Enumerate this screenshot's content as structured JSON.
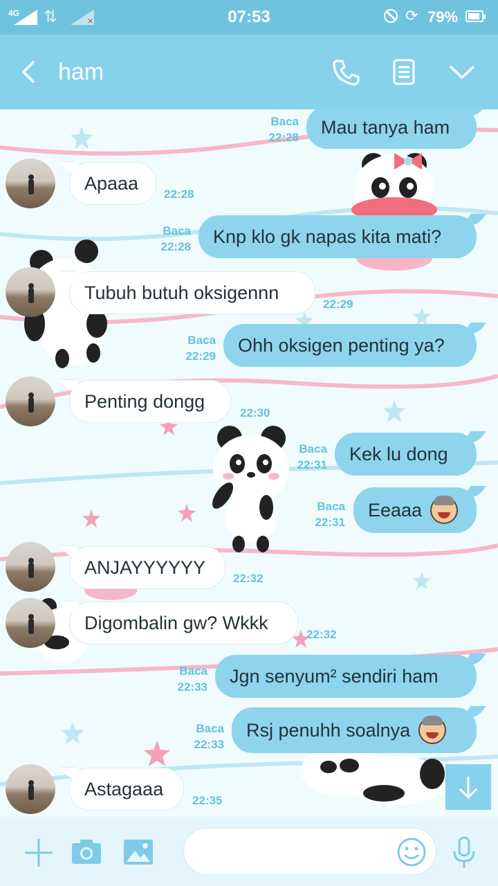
{
  "status_bar": {
    "network": "4G",
    "time": "07:53",
    "battery": "79%",
    "icons": [
      "signal-icon",
      "data-arrows-icon",
      "signal-no-sim-icon",
      "do-not-disturb-icon",
      "rotation-lock-icon",
      "battery-icon"
    ]
  },
  "header": {
    "contact_name": "ham",
    "icons": [
      "back-icon",
      "phone-icon",
      "notes-icon",
      "chevron-down-icon"
    ]
  },
  "messages": [
    {
      "direction": "out",
      "text": "Mau tanya ham",
      "status": "Baca",
      "time": "22:28",
      "emoji": false
    },
    {
      "direction": "in",
      "text": "Apaaa",
      "time": "22:28"
    },
    {
      "direction": "out",
      "text": "Knp klo gk napas kita mati?",
      "status": "Baca",
      "time": "22:28",
      "emoji": false
    },
    {
      "direction": "in",
      "text": "Tubuh butuh oksigennn",
      "time": "22:29"
    },
    {
      "direction": "out",
      "text": "Ohh oksigen penting ya?",
      "status": "Baca",
      "time": "22:29",
      "emoji": false
    },
    {
      "direction": "in",
      "text": "Penting dongg",
      "time": "22:30"
    },
    {
      "direction": "out",
      "text": "Kek lu dong",
      "status": "Baca",
      "time": "22:31",
      "emoji": false
    },
    {
      "direction": "out",
      "text": "Eeaaa",
      "status": "Baca",
      "time": "22:31",
      "emoji": true
    },
    {
      "direction": "in",
      "text": "ANJAYYYYYY",
      "time": "22:32"
    },
    {
      "direction": "in",
      "text": "Digombalin gw? Wkkk",
      "time": "22:32"
    },
    {
      "direction": "out",
      "text": "Jgn senyum² sendiri ham",
      "status": "Baca",
      "time": "22:33",
      "emoji": false
    },
    {
      "direction": "out",
      "text": "Rsj penuhh soalnya",
      "status": "Baca",
      "time": "22:33",
      "emoji": true
    },
    {
      "direction": "in",
      "text": "Astagaaa",
      "time": "22:35"
    }
  ],
  "input": {
    "value": "",
    "placeholder": ""
  },
  "bottom_bar": {
    "icons": [
      "plus-icon",
      "camera-icon",
      "image-icon",
      "emoji-icon",
      "microphone-icon"
    ]
  },
  "colors": {
    "status_bar": "#70c3df",
    "header": "#86d2ec",
    "outgoing_bubble": "#8dd4ec",
    "incoming_bubble": "#ffffff",
    "timestamp": "#63c3dc"
  }
}
